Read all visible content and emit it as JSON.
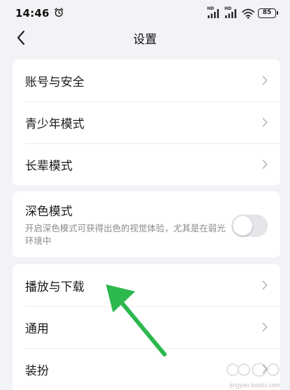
{
  "status": {
    "time": "14:46",
    "signal_1": "HD",
    "signal_2": "HD",
    "battery": "85"
  },
  "nav": {
    "title": "设置"
  },
  "group1": {
    "items": [
      {
        "label": "账号与安全"
      },
      {
        "label": "青少年模式"
      },
      {
        "label": "长辈模式"
      }
    ]
  },
  "dark_mode": {
    "title": "深色模式",
    "description": "开启深色模式可获得出色的视觉体验，尤其是在弱光环境中",
    "enabled": false
  },
  "group3": {
    "items": [
      {
        "label": "播放与下载"
      },
      {
        "label": "通用"
      },
      {
        "label": "装扮"
      }
    ]
  },
  "watermark": {
    "text": "jingyan.baidu.com"
  },
  "colors": {
    "background": "#f2f3f6",
    "card": "#ffffff",
    "arrow": "#2db84d",
    "toggle_off": "#e5e5ea"
  }
}
